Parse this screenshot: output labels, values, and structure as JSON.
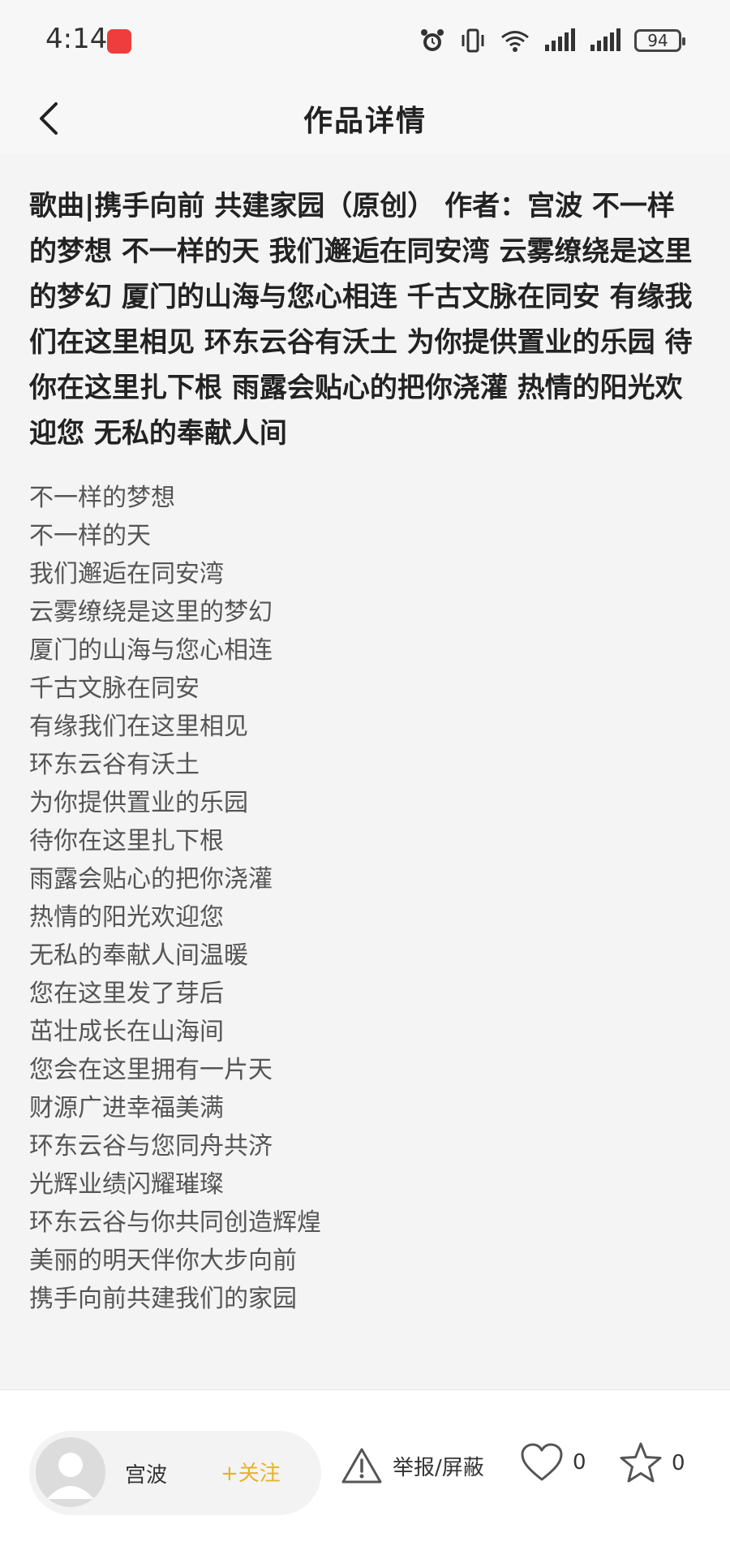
{
  "status_bar": {
    "time": "4:14",
    "battery": "94"
  },
  "header": {
    "title": "作品详情"
  },
  "work": {
    "title": "歌曲|携手向前 共建家园（原创） 作者：宫波 不一样的梦想 不一样的天 我们邂逅在同安湾 云雾缭绕是这里的梦幻 厦门的山海与您心相连 千古文脉在同安 有缘我们在这里相见 环东云谷有沃土 为你提供置业的乐园 待你在这里扎下根 雨露会贴心的把你浇灌 热情的阳光欢迎您 无私的奉献人间",
    "lyrics": [
      "不一样的梦想",
      "不一样的天",
      "我们邂逅在同安湾",
      "云雾缭绕是这里的梦幻",
      "厦门的山海与您心相连",
      "千古文脉在同安",
      "有缘我们在这里相见",
      "环东云谷有沃土",
      "为你提供置业的乐园",
      "待你在这里扎下根",
      "雨露会贴心的把你浇灌",
      "热情的阳光欢迎您",
      "无私的奉献人间温暖",
      "您在这里发了芽后",
      "茁壮成长在山海间",
      "您会在这里拥有一片天",
      "财源广进幸福美满",
      "环东云谷与您同舟共济",
      "光辉业绩闪耀璀璨",
      "环东云谷与你共同创造辉煌",
      "美丽的明天伴你大步向前",
      "携手向前共建我们的家园"
    ]
  },
  "footer": {
    "author_name": "宫波",
    "follow_label": "+关注",
    "report_label": "举报/屏蔽",
    "like_count": "0",
    "favorite_count": "0"
  },
  "colors": {
    "follow": "#e6b422",
    "background": "#f4f4f5"
  },
  "icons": [
    "back-icon",
    "alarm-icon",
    "vibrate-icon",
    "wifi-icon",
    "signal-icon",
    "battery-icon",
    "warning-icon",
    "heart-icon",
    "star-icon",
    "avatar-icon"
  ]
}
